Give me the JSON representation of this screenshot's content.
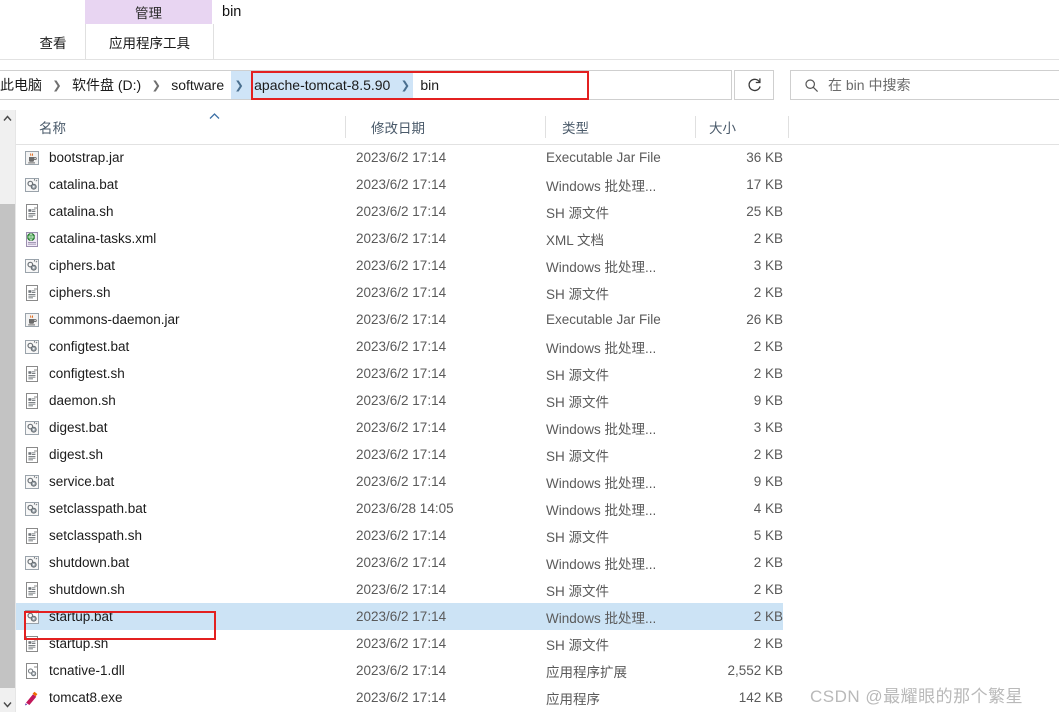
{
  "ribbon": {
    "contextual_group_label": "管理",
    "tabs": [
      {
        "label": "",
        "name": "tab-truncated"
      },
      {
        "label": "查看",
        "name": "tab-view"
      },
      {
        "label": "应用程序工具",
        "name": "tab-app-tools"
      }
    ],
    "window_title": "bin",
    "accent_contextual_color": "#E8D5F2"
  },
  "navbar": {
    "breadcrumbs": [
      {
        "label": "此电脑",
        "highlighted": false
      },
      {
        "label": "软件盘 (D:)",
        "highlighted": false
      },
      {
        "label": "software",
        "highlighted": false
      },
      {
        "label": "apache-tomcat-8.5.90",
        "highlighted": true
      },
      {
        "label": "bin",
        "highlighted": false
      }
    ],
    "dropdown_icon": "chevron-down-icon",
    "refresh_icon": "refresh-icon",
    "highlight_color": "#CFE4F7",
    "annotation_color": "#E32020"
  },
  "search": {
    "icon": "search-icon",
    "placeholder": "在 bin 中搜索"
  },
  "columns": [
    {
      "key": "name",
      "label": "名称",
      "sorted": true,
      "sort_direction": "asc"
    },
    {
      "key": "date",
      "label": "修改日期",
      "sorted": false
    },
    {
      "key": "type",
      "label": "类型",
      "sorted": false
    },
    {
      "key": "size",
      "label": "大小",
      "sorted": false
    }
  ],
  "files": [
    {
      "name": "bootstrap.jar",
      "icon": "jar-file-icon",
      "date": "2023/6/2 17:14",
      "type": "Executable Jar File",
      "size": "36 KB",
      "selected": false
    },
    {
      "name": "catalina.bat",
      "icon": "bat-file-icon",
      "date": "2023/6/2 17:14",
      "type": "Windows 批处理...",
      "size": "17 KB",
      "selected": false
    },
    {
      "name": "catalina.sh",
      "icon": "sh-file-icon",
      "date": "2023/6/2 17:14",
      "type": "SH 源文件",
      "size": "25 KB",
      "selected": false
    },
    {
      "name": "catalina-tasks.xml",
      "icon": "xml-file-icon",
      "date": "2023/6/2 17:14",
      "type": "XML 文档",
      "size": "2 KB",
      "selected": false
    },
    {
      "name": "ciphers.bat",
      "icon": "bat-file-icon",
      "date": "2023/6/2 17:14",
      "type": "Windows 批处理...",
      "size": "3 KB",
      "selected": false
    },
    {
      "name": "ciphers.sh",
      "icon": "sh-file-icon",
      "date": "2023/6/2 17:14",
      "type": "SH 源文件",
      "size": "2 KB",
      "selected": false
    },
    {
      "name": "commons-daemon.jar",
      "icon": "jar-file-icon",
      "date": "2023/6/2 17:14",
      "type": "Executable Jar File",
      "size": "26 KB",
      "selected": false
    },
    {
      "name": "configtest.bat",
      "icon": "bat-file-icon",
      "date": "2023/6/2 17:14",
      "type": "Windows 批处理...",
      "size": "2 KB",
      "selected": false
    },
    {
      "name": "configtest.sh",
      "icon": "sh-file-icon",
      "date": "2023/6/2 17:14",
      "type": "SH 源文件",
      "size": "2 KB",
      "selected": false
    },
    {
      "name": "daemon.sh",
      "icon": "sh-file-icon",
      "date": "2023/6/2 17:14",
      "type": "SH 源文件",
      "size": "9 KB",
      "selected": false
    },
    {
      "name": "digest.bat",
      "icon": "bat-file-icon",
      "date": "2023/6/2 17:14",
      "type": "Windows 批处理...",
      "size": "3 KB",
      "selected": false
    },
    {
      "name": "digest.sh",
      "icon": "sh-file-icon",
      "date": "2023/6/2 17:14",
      "type": "SH 源文件",
      "size": "2 KB",
      "selected": false
    },
    {
      "name": "service.bat",
      "icon": "bat-file-icon",
      "date": "2023/6/2 17:14",
      "type": "Windows 批处理...",
      "size": "9 KB",
      "selected": false
    },
    {
      "name": "setclasspath.bat",
      "icon": "bat-file-icon",
      "date": "2023/6/28 14:05",
      "type": "Windows 批处理...",
      "size": "4 KB",
      "selected": false
    },
    {
      "name": "setclasspath.sh",
      "icon": "sh-file-icon",
      "date": "2023/6/2 17:14",
      "type": "SH 源文件",
      "size": "5 KB",
      "selected": false
    },
    {
      "name": "shutdown.bat",
      "icon": "bat-file-icon",
      "date": "2023/6/2 17:14",
      "type": "Windows 批处理...",
      "size": "2 KB",
      "selected": false
    },
    {
      "name": "shutdown.sh",
      "icon": "sh-file-icon",
      "date": "2023/6/2 17:14",
      "type": "SH 源文件",
      "size": "2 KB",
      "selected": false
    },
    {
      "name": "startup.bat",
      "icon": "bat-file-icon",
      "date": "2023/6/2 17:14",
      "type": "Windows 批处理...",
      "size": "2 KB",
      "selected": true
    },
    {
      "name": "startup.sh",
      "icon": "sh-file-icon",
      "date": "2023/6/2 17:14",
      "type": "SH 源文件",
      "size": "2 KB",
      "selected": false
    },
    {
      "name": "tcnative-1.dll",
      "icon": "dll-file-icon",
      "date": "2023/6/2 17:14",
      "type": "应用程序扩展",
      "size": "2,552 KB",
      "selected": false
    },
    {
      "name": "tomcat8.exe",
      "icon": "exe-file-icon",
      "date": "2023/6/2 17:14",
      "type": "应用程序",
      "size": "142 KB",
      "selected": false
    }
  ],
  "selection": {
    "selected_file": "startup.bat",
    "highlight_color": "#CCE3F5",
    "annotation_box_color": "#E32020"
  },
  "watermark": {
    "text": "CSDN @最耀眼的那个繁星"
  }
}
